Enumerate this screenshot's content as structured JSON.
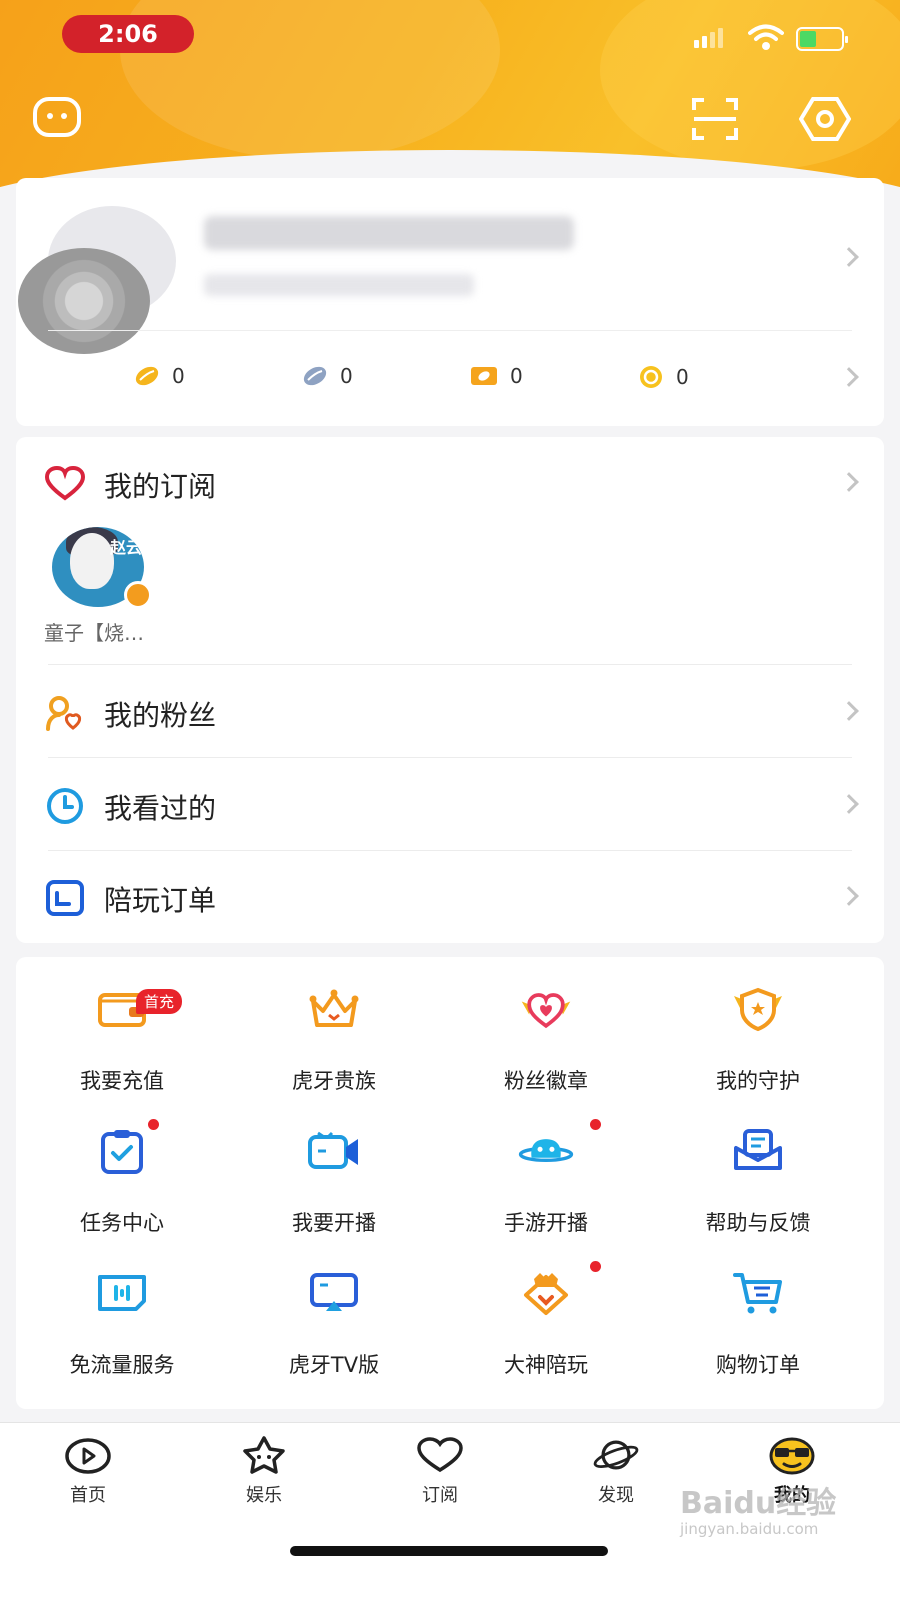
{
  "status_bar": {
    "time": "2:06"
  },
  "profile": {
    "stats": [
      {
        "icon": "gold-bean-icon",
        "value": "0"
      },
      {
        "icon": "silver-bean-icon",
        "value": "0"
      },
      {
        "icon": "ticket-icon",
        "value": "0"
      },
      {
        "icon": "coin-icon",
        "value": "0"
      }
    ]
  },
  "subscriptions": {
    "title": "我的订阅",
    "streamer_name": "童子【烧…",
    "avatar_text": "赵云"
  },
  "menu": {
    "fans": "我的粉丝",
    "history": "我看过的",
    "orders": "陪玩订单"
  },
  "grid": {
    "recharge_tag": "首充",
    "items": [
      {
        "label": "我要充值",
        "icon": "wallet-icon"
      },
      {
        "label": "虎牙贵族",
        "icon": "crown-icon"
      },
      {
        "label": "粉丝徽章",
        "icon": "heart-badge-icon"
      },
      {
        "label": "我的守护",
        "icon": "shield-badge-icon"
      },
      {
        "label": "任务中心",
        "icon": "task-clipboard-icon"
      },
      {
        "label": "我要开播",
        "icon": "camera-icon"
      },
      {
        "label": "手游开播",
        "icon": "gamepad-icon"
      },
      {
        "label": "帮助与反馈",
        "icon": "feedback-icon"
      },
      {
        "label": "免流量服务",
        "icon": "sim-card-icon"
      },
      {
        "label": "虎牙TV版",
        "icon": "tv-icon"
      },
      {
        "label": "大神陪玩",
        "icon": "god-badge-icon"
      },
      {
        "label": "购物订单",
        "icon": "shopping-cart-icon"
      }
    ]
  },
  "tabbar": {
    "tabs": [
      {
        "label": "首页",
        "icon": "home-tab-icon"
      },
      {
        "label": "娱乐",
        "icon": "star-tab-icon"
      },
      {
        "label": "订阅",
        "icon": "heart-tab-icon"
      },
      {
        "label": "发现",
        "icon": "planet-tab-icon"
      },
      {
        "label": "我的",
        "icon": "me-tab-icon"
      }
    ],
    "active": "我的"
  },
  "watermark": {
    "main": "Baidu经验",
    "sub": "jingyan.baidu.com"
  },
  "colors": {
    "header": "#f7ab1a",
    "accent_red": "#e8232b",
    "blue": "#1d6fd8"
  }
}
